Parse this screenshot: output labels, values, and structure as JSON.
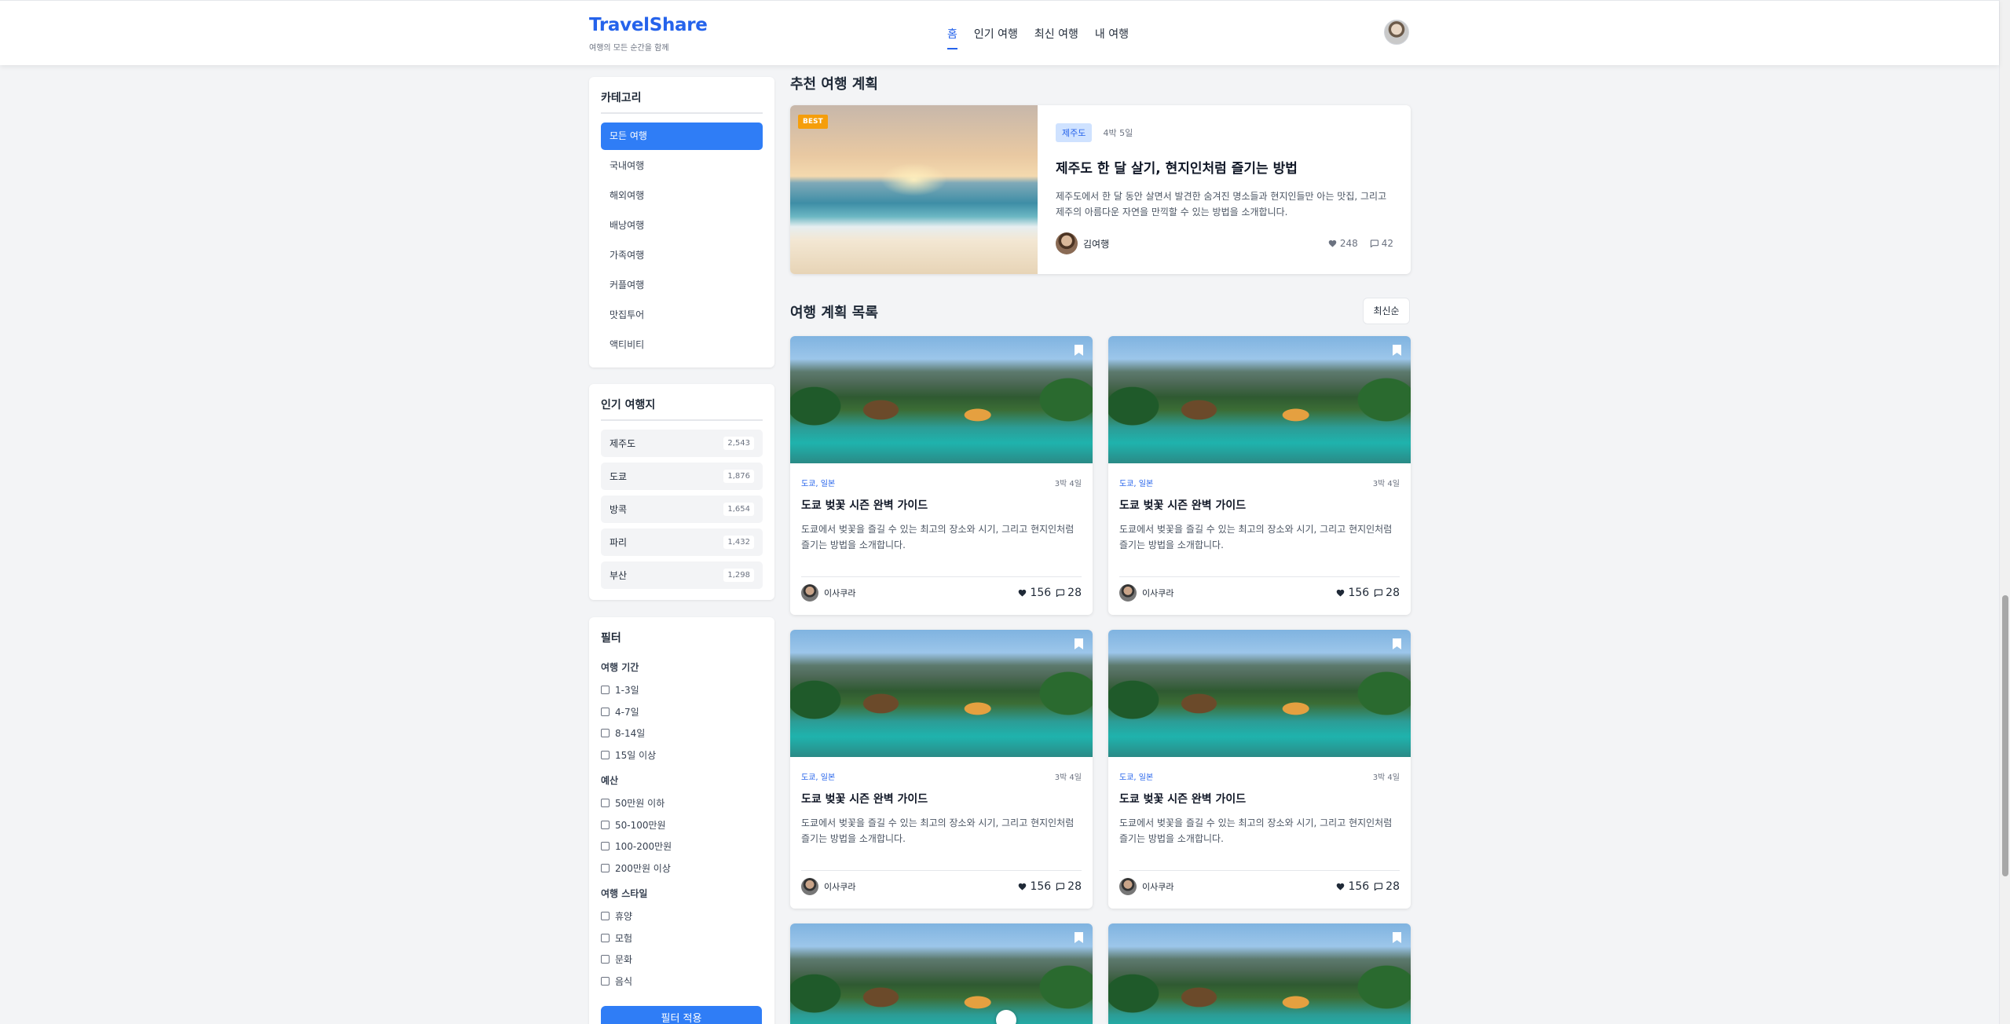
{
  "header": {
    "brand": "TravelShare",
    "tagline": "여행의 모든 순간을 함께",
    "nav": [
      {
        "label": "홈",
        "active": true
      },
      {
        "label": "인기 여행",
        "active": false
      },
      {
        "label": "최신 여행",
        "active": false
      },
      {
        "label": "내 여행",
        "active": false
      }
    ]
  },
  "sidebar": {
    "categories": {
      "title": "카테고리",
      "items": [
        "모든 여행",
        "국내여행",
        "해외여행",
        "배낭여행",
        "가족여행",
        "커플여행",
        "맛집투어",
        "액티비티"
      ],
      "active_index": 0
    },
    "popular": {
      "title": "인기 여행지",
      "items": [
        {
          "name": "제주도",
          "count": "2,543"
        },
        {
          "name": "도쿄",
          "count": "1,876"
        },
        {
          "name": "방콕",
          "count": "1,654"
        },
        {
          "name": "파리",
          "count": "1,432"
        },
        {
          "name": "부산",
          "count": "1,298"
        }
      ]
    },
    "filters": {
      "title": "필터",
      "groups": [
        {
          "label": "여행 기간",
          "options": [
            "1-3일",
            "4-7일",
            "8-14일",
            "15일 이상"
          ]
        },
        {
          "label": "예산",
          "options": [
            "50만원 이하",
            "50-100만원",
            "100-200만원",
            "200만원 이상"
          ]
        },
        {
          "label": "여행 스타일",
          "options": [
            "휴양",
            "모험",
            "문화",
            "음식"
          ]
        }
      ],
      "apply_label": "필터 적용"
    }
  },
  "featured": {
    "section_title": "추천 여행 계획",
    "badge": "BEST",
    "tag": "제주도",
    "duration": "4박 5일",
    "title": "제주도 한 달 살기, 현지인처럼 즐기는 방법",
    "description": "제주도에서 한 달 동안 살면서 발견한 숨겨진 명소들과 현지인들만 아는 맛집, 그리고 제주의 아름다운 자연을 만끽할 수 있는 방법을 소개합니다.",
    "author": "김여행",
    "likes": "248",
    "comments": "42"
  },
  "list": {
    "section_title": "여행 계획 목록",
    "sort_label": "최신순",
    "cards": [
      {
        "location": "도쿄, 일본",
        "duration": "3박 4일",
        "title": "도쿄 벚꽃 시즌 완벽 가이드",
        "description": "도쿄에서 벚꽃을 즐길 수 있는 최고의 장소와 시기, 그리고 현지인처럼 즐기는 방법을 소개합니다.",
        "author": "이사쿠라",
        "likes": "156",
        "comments": "28"
      },
      {
        "location": "도쿄, 일본",
        "duration": "3박 4일",
        "title": "도쿄 벚꽃 시즌 완벽 가이드",
        "description": "도쿄에서 벚꽃을 즐길 수 있는 최고의 장소와 시기, 그리고 현지인처럼 즐기는 방법을 소개합니다.",
        "author": "이사쿠라",
        "likes": "156",
        "comments": "28"
      },
      {
        "location": "도쿄, 일본",
        "duration": "3박 4일",
        "title": "도쿄 벚꽃 시즌 완벽 가이드",
        "description": "도쿄에서 벚꽃을 즐길 수 있는 최고의 장소와 시기, 그리고 현지인처럼 즐기는 방법을 소개합니다.",
        "author": "이사쿠라",
        "likes": "156",
        "comments": "28"
      },
      {
        "location": "도쿄, 일본",
        "duration": "3박 4일",
        "title": "도쿄 벚꽃 시즌 완벽 가이드",
        "description": "도쿄에서 벚꽃을 즐길 수 있는 최고의 장소와 시기, 그리고 현지인처럼 즐기는 방법을 소개합니다.",
        "author": "이사쿠라",
        "likes": "156",
        "comments": "28"
      }
    ]
  },
  "colors": {
    "accent": "#2f7df6",
    "brand": "#2563eb",
    "best_badge": "#f59e0b",
    "tag_bg": "#cfe2ff"
  },
  "icons": [
    "heart-icon",
    "comment-icon",
    "bookmark-icon",
    "user-avatar"
  ]
}
